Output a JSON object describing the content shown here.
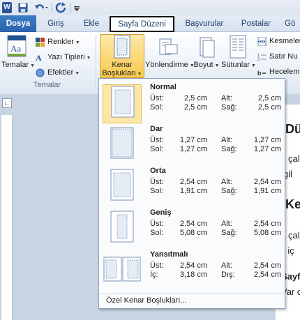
{
  "tabs": {
    "file": "Dosya",
    "home": "Giriş",
    "insert": "Ekle",
    "page_layout": "Sayfa Düzeni",
    "references": "Başvurular",
    "mailings": "Postalar",
    "review": "Gö"
  },
  "ribbon": {
    "themes_label": "Temalar",
    "colors_label": "Renkler",
    "fonts_label": "Yazı Tipleri",
    "effects_label": "Efektler",
    "themes_group": "Temalar",
    "margins_label_1": "Kenar",
    "margins_label_2": "Boşlukları",
    "orientation_label": "Yönlendirme",
    "size_label": "Boyut",
    "columns_label": "Sütunlar",
    "breaks_label": "Kesmeler",
    "line_numbers_label": "Satır Nu",
    "hyphenation_label": "Hecelem"
  },
  "document": {
    "line1": "Dü",
    "line2": "çal",
    "line3": "e gil",
    "line4": "Ke",
    "line5": "çal",
    "line6": "ak iç",
    "line7": "Sayf",
    "line8": "Var c"
  },
  "margins_menu": {
    "options": [
      {
        "name": "Normal",
        "l1": "Üst:",
        "v1": "2,5 cm",
        "l2": "Alt:",
        "v2": "2,5 cm",
        "l3": "Sol:",
        "v3": "2,5 cm",
        "l4": "Sağ:",
        "v4": "2,5 cm"
      },
      {
        "name": "Dar",
        "l1": "Üst:",
        "v1": "1,27 cm",
        "l2": "Alt:",
        "v2": "1,27 cm",
        "l3": "Sol:",
        "v3": "1,27 cm",
        "l4": "Sağ:",
        "v4": "1,27 cm"
      },
      {
        "name": "Orta",
        "l1": "Üst:",
        "v1": "2,54 cm",
        "l2": "Alt:",
        "v2": "2,54 cm",
        "l3": "Sol:",
        "v3": "1,91 cm",
        "l4": "Sağ:",
        "v4": "1,91 cm"
      },
      {
        "name": "Geniş",
        "l1": "Üst:",
        "v1": "2,54 cm",
        "l2": "Alt:",
        "v2": "2,54 cm",
        "l3": "Sol:",
        "v3": "5,08 cm",
        "l4": "Sağ:",
        "v4": "5,08 cm"
      },
      {
        "name": "Yansıtmalı",
        "l1": "Üst:",
        "v1": "2,54 cm",
        "l2": "Alt:",
        "v2": "2,54 cm",
        "l3": "İç:",
        "v3": "3,18 cm",
        "l4": "Dış:",
        "v4": "2,54 cm"
      }
    ],
    "custom_label": "Özel Kenar Boşlukları..."
  }
}
